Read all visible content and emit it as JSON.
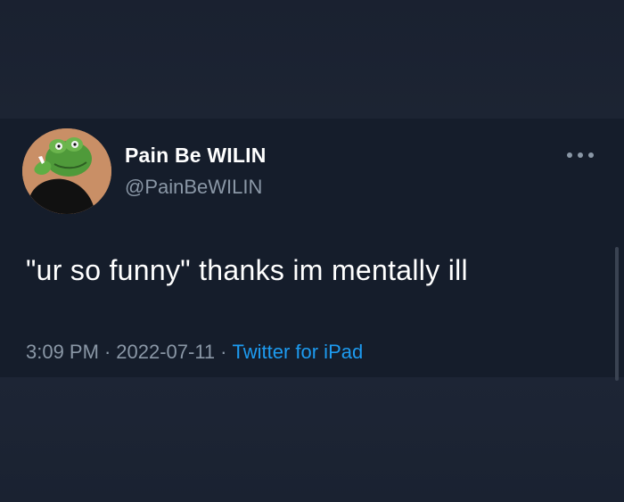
{
  "tweet": {
    "display_name": "Pain Be WILIN",
    "handle": "@PainBeWILIN",
    "text": "\"ur so funny\" thanks im mentally ill",
    "time": "3:09 PM",
    "separator": "·",
    "date": "2022-07-11",
    "source": "Twitter for iPad",
    "avatar_icon": "kermit-avatar",
    "more_icon": "more-options-icon"
  },
  "colors": {
    "background": "#151d2b",
    "text_primary": "#ffffff",
    "text_secondary": "#8a97a6",
    "link": "#1d9bf0"
  }
}
